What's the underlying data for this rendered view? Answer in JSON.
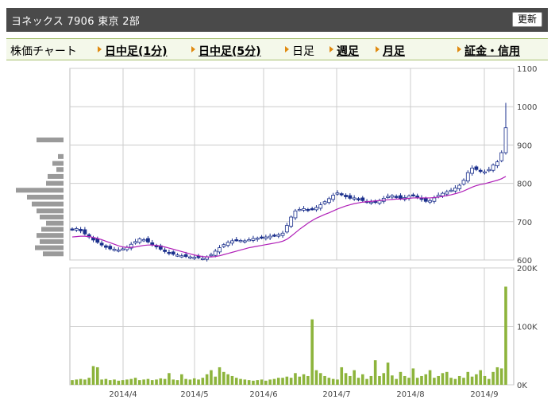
{
  "header": {
    "title": "ヨネックス 7906 東京 2部",
    "refresh_label": "更新"
  },
  "nav": {
    "heading": "株価チャート",
    "links": [
      {
        "label": "日中足(1分)"
      },
      {
        "label": "日中足(5分)"
      },
      {
        "label": "日足"
      },
      {
        "label": "週足"
      },
      {
        "label": "月足"
      },
      {
        "label": "証金・信用"
      }
    ]
  },
  "colors": {
    "price_up": "#ffffff",
    "price_down": "#1a2f8c",
    "moving_average": "#b020b8",
    "volume": "#8db43c",
    "volume_profile": "#9a9a9a",
    "grid": "#cccccc"
  },
  "chart_data": [
    {
      "type": "candlestick",
      "title": "",
      "ylim": [
        600,
        1100
      ],
      "yticks": [
        600,
        700,
        800,
        900,
        1000,
        1100
      ],
      "xticks": [
        "2014/4",
        "2014/5",
        "2014/6",
        "2014/7",
        "2014/8",
        "2014/9"
      ],
      "grid": true,
      "close": [
        680,
        682,
        676,
        668,
        660,
        652,
        646,
        639,
        633,
        629,
        628,
        626,
        629,
        633,
        641,
        648,
        655,
        653,
        647,
        640,
        634,
        628,
        622,
        618,
        615,
        613,
        611,
        609,
        608,
        607,
        606,
        604,
        608,
        614,
        623,
        632,
        640,
        646,
        650,
        652,
        651,
        650,
        653,
        656,
        657,
        658,
        660,
        662,
        664,
        666,
        670,
        690,
        712,
        728,
        732,
        734,
        731,
        733,
        737,
        744,
        752,
        760,
        769,
        775,
        771,
        765,
        761,
        762,
        759,
        755,
        752,
        751,
        750,
        755,
        761,
        766,
        768,
        765,
        760,
        763,
        767,
        769,
        764,
        758,
        753,
        755,
        762,
        769,
        774,
        778,
        782,
        788,
        795,
        808,
        828,
        840,
        836,
        831,
        830,
        836,
        848,
        856,
        880,
        945
      ],
      "series": [
        {
          "name": "",
          "type": "line",
          "values": [
            660,
            661,
            662,
            662,
            661,
            659,
            656,
            653,
            649,
            645,
            641,
            637,
            634,
            633,
            633,
            634,
            636,
            638,
            639,
            639,
            638,
            636,
            634,
            631,
            628,
            625,
            622,
            619,
            616,
            613,
            611,
            609,
            608,
            608,
            609,
            611,
            614,
            617,
            620,
            623,
            626,
            629,
            632,
            634,
            636,
            638,
            640,
            642,
            644,
            646,
            649,
            654,
            662,
            671,
            680,
            688,
            696,
            703,
            709,
            714,
            719,
            723,
            728,
            733,
            737,
            741,
            744,
            747,
            749,
            751,
            752,
            753,
            754,
            755,
            756,
            757,
            758,
            759,
            759,
            760,
            761,
            762,
            762,
            762,
            762,
            762,
            763,
            764,
            766,
            768,
            770,
            773,
            776,
            780,
            785,
            790,
            794,
            797,
            799,
            802,
            805,
            808,
            812,
            818
          ]
        }
      ]
    },
    {
      "type": "bar",
      "title": "",
      "ylim": [
        0,
        200000
      ],
      "yticks": [
        "0K",
        "100K",
        "200K"
      ],
      "xticks": [
        "2014/4",
        "2014/5",
        "2014/6",
        "2014/7",
        "2014/8",
        "2014/9"
      ],
      "grid": true,
      "series": [
        {
          "name": "",
          "values": [
            8000,
            9000,
            10000,
            9000,
            12000,
            32000,
            30000,
            9000,
            10000,
            8000,
            9000,
            7000,
            8000,
            9000,
            10000,
            12000,
            8000,
            9000,
            10000,
            8000,
            9000,
            11000,
            10000,
            20000,
            9000,
            8000,
            18000,
            10000,
            9000,
            11000,
            9000,
            12000,
            18000,
            25000,
            14000,
            30000,
            22000,
            18000,
            15000,
            12000,
            10000,
            9000,
            8000,
            7000,
            8000,
            9000,
            7000,
            9000,
            10000,
            12000,
            12000,
            14000,
            12000,
            20000,
            14000,
            18000,
            15000,
            112000,
            25000,
            20000,
            15000,
            12000,
            10000,
            9000,
            30000,
            20000,
            15000,
            25000,
            12000,
            18000,
            10000,
            15000,
            42000,
            15000,
            20000,
            38000,
            16000,
            10000,
            22000,
            15000,
            12000,
            28000,
            12000,
            15000,
            18000,
            25000,
            12000,
            15000,
            20000,
            22000,
            12000,
            10000,
            15000,
            12000,
            22000,
            14000,
            18000,
            25000,
            15000,
            10000,
            22000,
            30000,
            28000,
            168000
          ]
        }
      ]
    }
  ]
}
